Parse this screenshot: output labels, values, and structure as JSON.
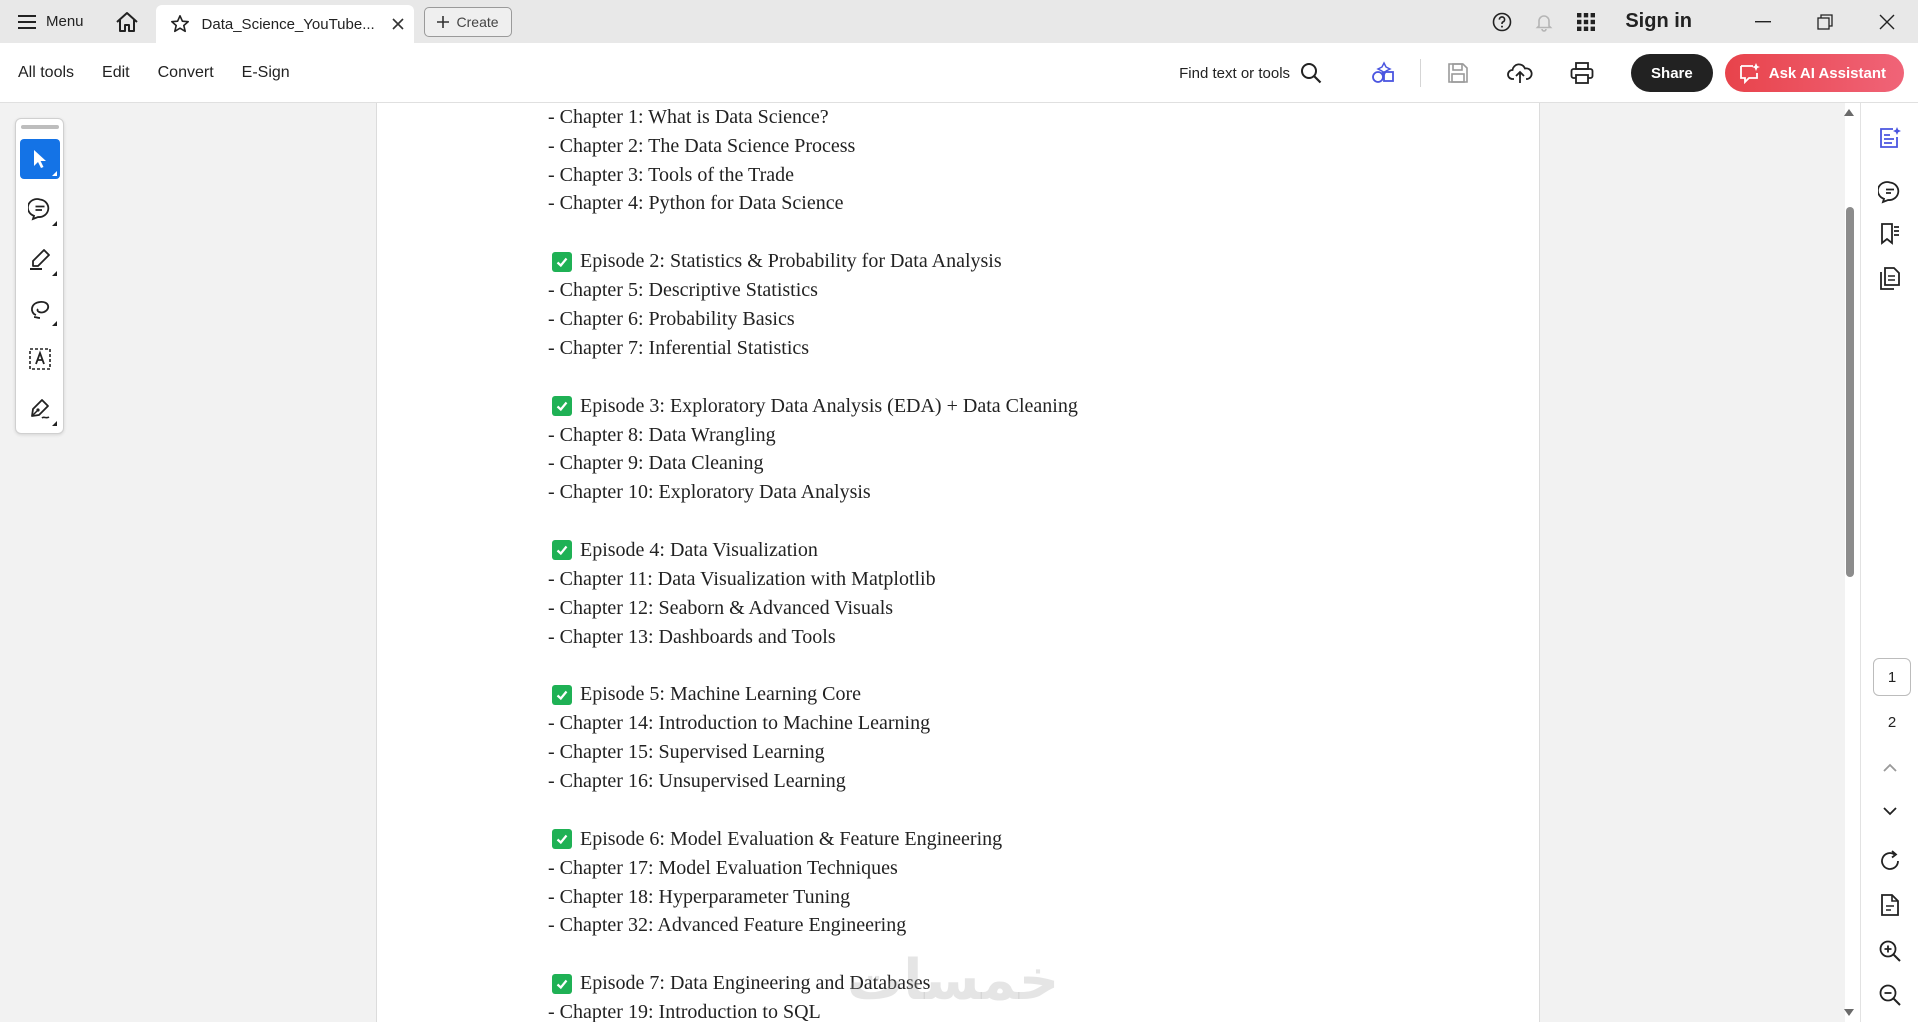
{
  "titlebar": {
    "menu_label": "Menu",
    "tab_title": "Data_Science_YouTube...",
    "create_label": "Create",
    "signin_label": "Sign in"
  },
  "toolbar": {
    "menus": [
      "All tools",
      "Edit",
      "Convert",
      "E-Sign"
    ],
    "find_label": "Find text or tools",
    "share_label": "Share",
    "ai_label": "Ask AI Assistant"
  },
  "document": {
    "lines": [
      {
        "kind": "chapter",
        "text": "- Chapter 1: What is Data Science?"
      },
      {
        "kind": "chapter",
        "text": "- Chapter 2: The Data Science Process"
      },
      {
        "kind": "chapter",
        "text": "- Chapter 3: Tools of the Trade"
      },
      {
        "kind": "chapter",
        "text": "- Chapter 4: Python for Data Science"
      },
      {
        "kind": "gap"
      },
      {
        "kind": "episode",
        "text": "Episode 2: Statistics & Probability for Data Analysis"
      },
      {
        "kind": "chapter",
        "text": "- Chapter 5: Descriptive Statistics"
      },
      {
        "kind": "chapter",
        "text": "- Chapter 6: Probability Basics"
      },
      {
        "kind": "chapter",
        "text": "- Chapter 7: Inferential Statistics"
      },
      {
        "kind": "gap"
      },
      {
        "kind": "episode",
        "text": "Episode 3: Exploratory Data Analysis (EDA) + Data Cleaning"
      },
      {
        "kind": "chapter",
        "text": "- Chapter 8: Data Wrangling"
      },
      {
        "kind": "chapter",
        "text": "- Chapter 9: Data Cleaning"
      },
      {
        "kind": "chapter",
        "text": "- Chapter 10: Exploratory Data Analysis"
      },
      {
        "kind": "gap"
      },
      {
        "kind": "episode",
        "text": "Episode 4: Data Visualization"
      },
      {
        "kind": "chapter",
        "text": "- Chapter 11: Data Visualization with Matplotlib"
      },
      {
        "kind": "chapter",
        "text": "- Chapter 12: Seaborn & Advanced Visuals"
      },
      {
        "kind": "chapter",
        "text": "- Chapter 13: Dashboards and Tools"
      },
      {
        "kind": "gap"
      },
      {
        "kind": "episode",
        "text": "Episode 5: Machine Learning Core"
      },
      {
        "kind": "chapter",
        "text": "- Chapter 14: Introduction to Machine Learning"
      },
      {
        "kind": "chapter",
        "text": "- Chapter 15: Supervised Learning"
      },
      {
        "kind": "chapter",
        "text": "- Chapter 16: Unsupervised Learning"
      },
      {
        "kind": "gap"
      },
      {
        "kind": "episode",
        "text": "Episode 6: Model Evaluation & Feature Engineering"
      },
      {
        "kind": "chapter",
        "text": "- Chapter 17: Model Evaluation Techniques"
      },
      {
        "kind": "chapter",
        "text": "- Chapter 18: Hyperparameter Tuning"
      },
      {
        "kind": "chapter",
        "text": "- Chapter 32: Advanced Feature Engineering"
      },
      {
        "kind": "gap"
      },
      {
        "kind": "episode",
        "text": "Episode 7: Data Engineering and Databases"
      },
      {
        "kind": "chapter",
        "text": "- Chapter 19: Introduction to SQL"
      }
    ],
    "watermark": "خمسات"
  },
  "pager": {
    "current_page": "1",
    "next_page": "2"
  },
  "colors": {
    "accent": "#1473e6",
    "check_green": "#1fb155",
    "ai_red": "#e8434b",
    "share_dark": "#222222"
  },
  "icons": {
    "left_tools": [
      "select-cursor-icon",
      "comment-icon",
      "highlight-pen-icon",
      "lasso-draw-icon",
      "text-box-icon",
      "sign-pen-icon"
    ],
    "right_rail": [
      "ai-summary-icon",
      "comments-panel-icon",
      "bookmarks-icon",
      "page-thumbnails-icon",
      "rotate-icon",
      "page-info-icon",
      "zoom-in-icon",
      "zoom-out-icon"
    ]
  }
}
